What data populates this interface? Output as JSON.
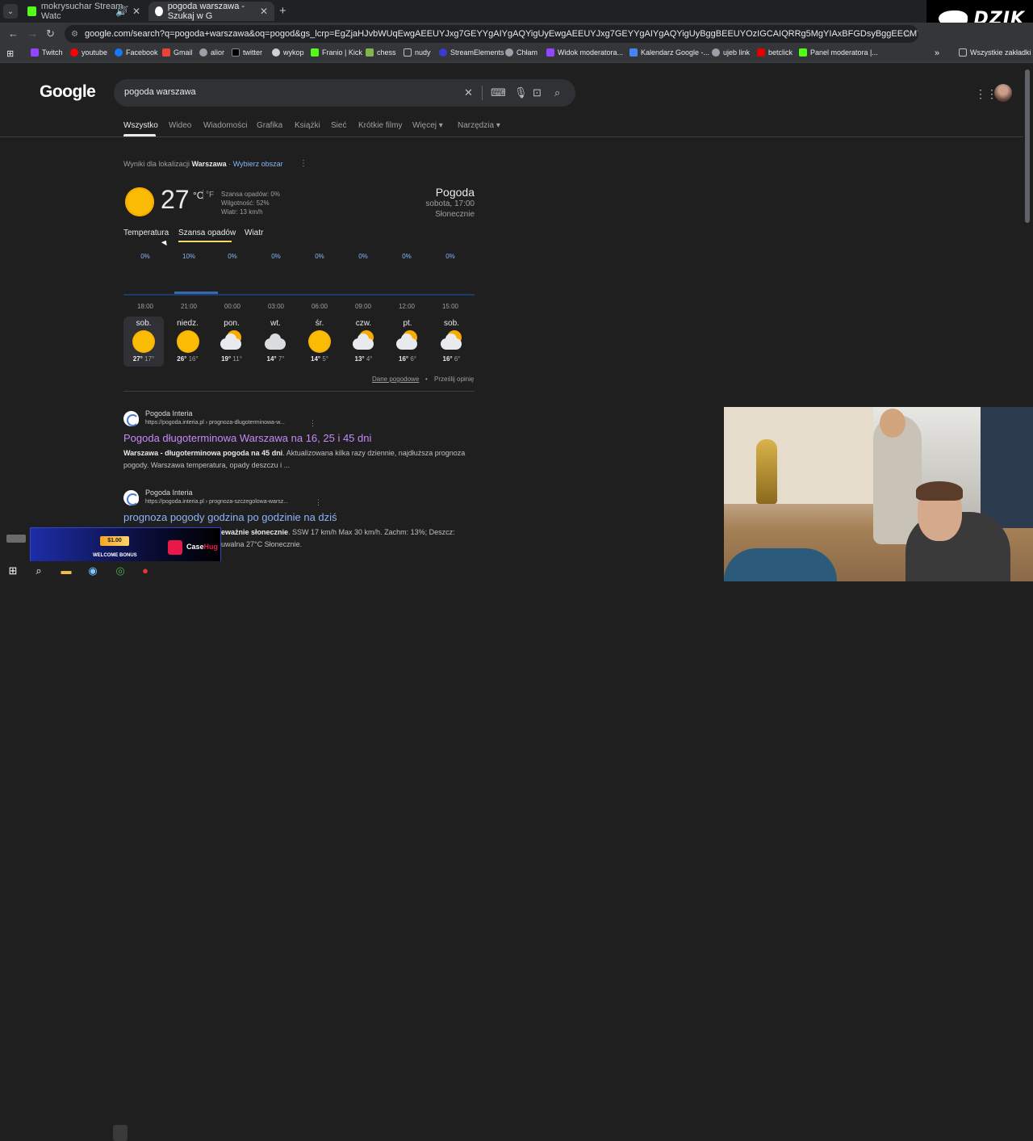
{
  "browser": {
    "tabs": [
      {
        "title": "mokrysuchar Stream - Watc",
        "active": false
      },
      {
        "title": "pogoda warszawa - Szukaj w G",
        "active": true
      }
    ],
    "url": "google.com/search?q=pogoda+warszawa&oq=pogod&gs_lcrp=EgZjaHJvbWUqEwgAEEUYJxg7GEYYgAIYgAQYigUyEwgAEEUYJxg7GEYYgAIYgAQYigUyBggBEEUYOzIGCAIQRRg5MgYIAxBFGDsyBggEECMYJzIKCAUQABiSAxiABDISCAYQABhDGJIDG...",
    "bookmarks": [
      "Twitch",
      "youtube",
      "Facebook",
      "Gmail",
      "alior",
      "twitter",
      "wykop",
      "Franio | Kick",
      "chess",
      "nudy",
      "StreamElements",
      "Chłam",
      "Widok moderatora...",
      "Kalendarz Google -...",
      "ujeb link",
      "betclick",
      "Panel moderatora |..."
    ],
    "bookmarks_folder": "Wszystkie zakładki"
  },
  "overlay": {
    "brand": "DZIK",
    "promo_amount": "$1.00",
    "promo_text": "WELCOME BONUS",
    "promo_brand_a": "Case",
    "promo_brand_b": "Hug"
  },
  "google": {
    "logo": "Google",
    "query": "pogoda warszawa",
    "tabs": [
      "Wszystko",
      "Wideo",
      "Wiadomości",
      "Grafika",
      "Książki",
      "Sieć",
      "Krótkie filmy",
      "Więcej",
      "Narzędzia"
    ],
    "location_prefix": "Wyniki dla lokalizacji",
    "location_city": "Warszawa",
    "location_sep": "·",
    "location_change": "Wybierz obszar"
  },
  "weather": {
    "temp": "27",
    "unit_c": "°C",
    "unit_f": "°F",
    "precip": "Szansa opadów: 0%",
    "humidity": "Wilgotność: 52%",
    "wind": "Wiatr: 13 km/h",
    "title": "Pogoda",
    "datetime": "sobota, 17:00",
    "condition": "Słonecznie",
    "tabs": [
      "Temperatura",
      "Szansa opadów",
      "Wiatr"
    ],
    "chart_percent": [
      "0%",
      "10%",
      "0%",
      "0%",
      "0%",
      "0%",
      "0%",
      "0%"
    ],
    "chart_percent_values": [
      0,
      10,
      0,
      0,
      0,
      0,
      0,
      0
    ],
    "chart_times": [
      "18:00",
      "21:00",
      "00:00",
      "03:00",
      "06:00",
      "09:00",
      "12:00",
      "15:00"
    ],
    "days": [
      {
        "name": "sob.",
        "icon": "sun-icon",
        "hi": "27°",
        "lo": "17°"
      },
      {
        "name": "niedz.",
        "icon": "sun-icon",
        "hi": "26°",
        "lo": "16°"
      },
      {
        "name": "pon.",
        "icon": "partly-cloudy-icon",
        "hi": "19°",
        "lo": "11°"
      },
      {
        "name": "wt.",
        "icon": "cloud-icon",
        "hi": "14°",
        "lo": "7°"
      },
      {
        "name": "śr.",
        "icon": "sun-icon",
        "hi": "14°",
        "lo": "5°"
      },
      {
        "name": "czw.",
        "icon": "partly-cloudy-icon",
        "hi": "13°",
        "lo": "4°"
      },
      {
        "name": "pt.",
        "icon": "partly-cloudy-icon",
        "hi": "16°",
        "lo": "6°"
      },
      {
        "name": "sob.",
        "icon": "partly-cloudy-icon",
        "hi": "16°",
        "lo": "6°"
      }
    ],
    "footer_data": "Dane pogodowe",
    "footer_dot": "•",
    "footer_feedback": "Prześlij opinię"
  },
  "results": [
    {
      "site": "Pogoda Interia",
      "url": "https://pogoda.interia.pl › prognoza-dlugoterminowa-w...",
      "title": "Pogoda długoterminowa Warszawa na 16, 25 i 45 dni",
      "snippet_bold": "Warszawa - długoterminowa pogoda na 45 dni",
      "snippet": ". Aktualizowana kilka razy dziennie, najdłuższa prognoza pogody. Warszawa temperatura, opady deszczu i ..."
    },
    {
      "site": "Pogoda Interia",
      "url": "https://pogoda.interia.pl › prognoza-szczegolowa-warsz...",
      "title": "prognoza pogody godzina po godzinie na dziś",
      "snippet_bold": "eważnie słonecznie",
      "snippet": ". SSW 17 km/h Max 30 km/h. Zachm: 13%; Deszcz:",
      "snippet2": "uwalna 27°C Słonecznie."
    }
  ]
}
